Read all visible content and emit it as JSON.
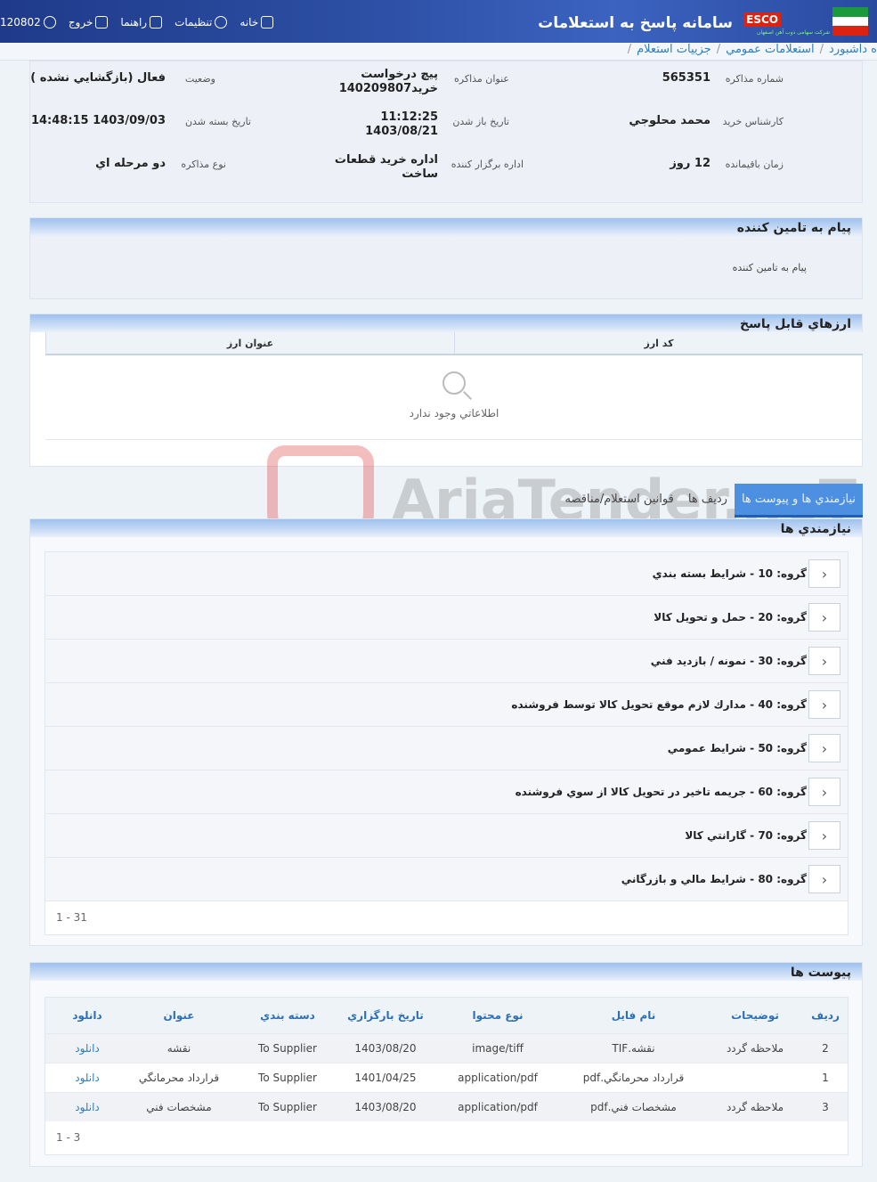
{
  "header": {
    "title": "سامانه پاسخ به استعلامات",
    "logo_text": "ESCO",
    "logo_sub": "شرکت سهامی ذوب آهن اصفهان",
    "nav": {
      "home": "خانه",
      "settings": "تنظیمات",
      "help": "راهنما",
      "logout": "خروج",
      "user_id": "120802"
    }
  },
  "breadcrumb": [
    "ه داشبورد",
    "استعلامات عمومي",
    "جزييات استعلام"
  ],
  "info": {
    "fields": {
      "number_label": "شماره مذاکره",
      "number_value": "565351",
      "subject_label": "عنوان مذاکره",
      "subject_value_1": "پيچ درخواست",
      "subject_value_2": "خريد140209807",
      "status_label": "وضعيت",
      "status_value": "فعال (بازگشايي نشده )",
      "expert_label": "کارشناس خريد",
      "expert_value": "محمد محلوجي",
      "open_label": "تاريخ باز شدن",
      "open_time": "11:12:25",
      "open_date": "1403/08/21",
      "close_label": "تاريخ بسته شدن",
      "close_value": "1403/09/03 14:48:15",
      "remaining_label": "زمان باقيمانده",
      "remaining_value": "12 روز",
      "org_label": "اداره برگزار کننده",
      "org_value_1": "اداره خريد قطعات",
      "org_value_2": "ساخت",
      "type_label": "نوع مذاکره",
      "type_value": "دو مرحله اي"
    }
  },
  "message_panel": {
    "title": "پيام به تامين کننده",
    "body": "پيام به تامين کننده"
  },
  "currency_panel": {
    "title": "ارزهاي قابل پاسخ",
    "columns": [
      "کد ارز",
      "عنوان ارز"
    ],
    "empty_text": "اطلاعاتي وجود ندارد"
  },
  "tabs": {
    "active_1": "نيازمندي ها",
    "active_2": "و پيوست ها",
    "rows": "رديف ها",
    "rules": "قوانين استعلام/مناقصه"
  },
  "requirements": {
    "title": "نيازمندي ها",
    "groups": [
      "گروه: 10 - شرايط بسته بندي",
      "گروه: 20 - حمل و تحويل کالا",
      "گروه: 30 - نمونه / بازديد فني",
      "گروه: 40 - مدارك لازم موقع تحويل كالا توسط فروشنده",
      "گروه: 50 - شرايط عمومي",
      "گروه: 60 - جريمه تاخير در تحويل کالا از سوي فروشنده",
      "گروه: 70 - گارانتي کالا",
      "گروه: 80 - شرايط مالي و بازرگاني"
    ],
    "pager": "1 - 31"
  },
  "attachments": {
    "title": "پيوست ها",
    "columns": [
      "رديف",
      "توضيحات",
      "نام فايل",
      "نوع محتوا",
      "تاريخ بارگزاري",
      "دسته بندي",
      "عنوان",
      "دانلود"
    ],
    "rows": [
      [
        "2",
        "ملاحظه گردد",
        "نقشه.TIF",
        "image/tiff",
        "1403/08/20",
        "To Supplier",
        "نقشه",
        "دانلود"
      ],
      [
        "1",
        "",
        "قرارداد محرمانگي.pdf",
        "application/pdf",
        "1401/04/25",
        "To Supplier",
        "قرارداد محرمانگي",
        "دانلود"
      ],
      [
        "3",
        "ملاحظه گردد",
        "مشخصات فني.pdf",
        "application/pdf",
        "1403/08/20",
        "To Supplier",
        "مشخصات فني",
        "دانلود"
      ]
    ],
    "pager": "1 - 3"
  },
  "watermark": "AriaTender.neT"
}
